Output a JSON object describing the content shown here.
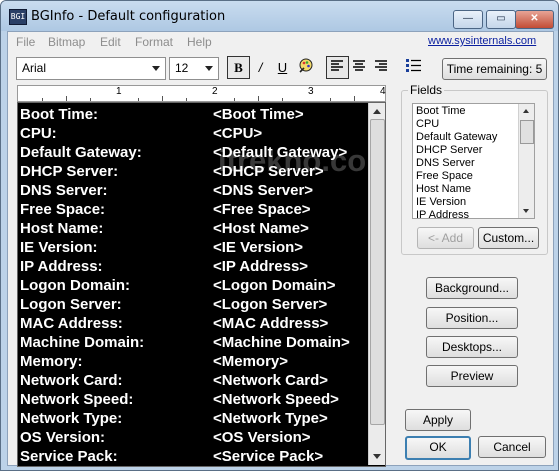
{
  "window": {
    "title": "BGInfo - Default configuration",
    "app_icon_text": "BGI",
    "controls": {
      "minimize": "—",
      "maximize": "▭",
      "close": "✕"
    }
  },
  "menu": {
    "items": [
      "File",
      "Bitmap",
      "Edit",
      "Format",
      "Help"
    ],
    "link": "www.sysinternals.com"
  },
  "toolbar": {
    "font": "Arial",
    "size": "12",
    "bold": "B",
    "italic": "/",
    "underline": "U",
    "time_remaining": "Time remaining: 5"
  },
  "ruler": {
    "marks": [
      "1",
      "2",
      "3",
      "4"
    ]
  },
  "editor": {
    "lines": [
      {
        "label": "Boot Time:",
        "value": "<Boot Time>"
      },
      {
        "label": "CPU:",
        "value": "<CPU>"
      },
      {
        "label": "Default Gateway:",
        "value": "<Default Gateway>"
      },
      {
        "label": "DHCP Server:",
        "value": "<DHCP Server>"
      },
      {
        "label": "DNS Server:",
        "value": "<DNS Server>"
      },
      {
        "label": "Free Space:",
        "value": "<Free Space>"
      },
      {
        "label": "Host Name:",
        "value": "<Host Name>"
      },
      {
        "label": "IE Version:",
        "value": "<IE Version>"
      },
      {
        "label": "IP Address:",
        "value": "<IP Address>"
      },
      {
        "label": "Logon Domain:",
        "value": "<Logon Domain>"
      },
      {
        "label": "Logon Server:",
        "value": "<Logon Server>"
      },
      {
        "label": "MAC Address:",
        "value": "<MAC Address>"
      },
      {
        "label": "Machine Domain:",
        "value": "<Machine Domain>"
      },
      {
        "label": "Memory:",
        "value": "<Memory>"
      },
      {
        "label": "Network Card:",
        "value": "<Network Card>"
      },
      {
        "label": "Network Speed:",
        "value": "<Network Speed>"
      },
      {
        "label": "Network Type:",
        "value": "<Network Type>"
      },
      {
        "label": "OS Version:",
        "value": "<OS Version>"
      },
      {
        "label": "Service Pack:",
        "value": "<Service Pack>"
      }
    ],
    "watermark": "itrekno.com"
  },
  "fields": {
    "legend": "Fields",
    "items": [
      "Boot Time",
      "CPU",
      "Default Gateway",
      "DHCP Server",
      "DNS Server",
      "Free Space",
      "Host Name",
      "IE Version",
      "IP Address"
    ],
    "add_label": "<- Add",
    "custom_label": "Custom..."
  },
  "buttons": {
    "background": "Background...",
    "position": "Position...",
    "desktops": "Desktops...",
    "preview": "Preview",
    "apply": "Apply",
    "ok": "OK",
    "cancel": "Cancel"
  }
}
